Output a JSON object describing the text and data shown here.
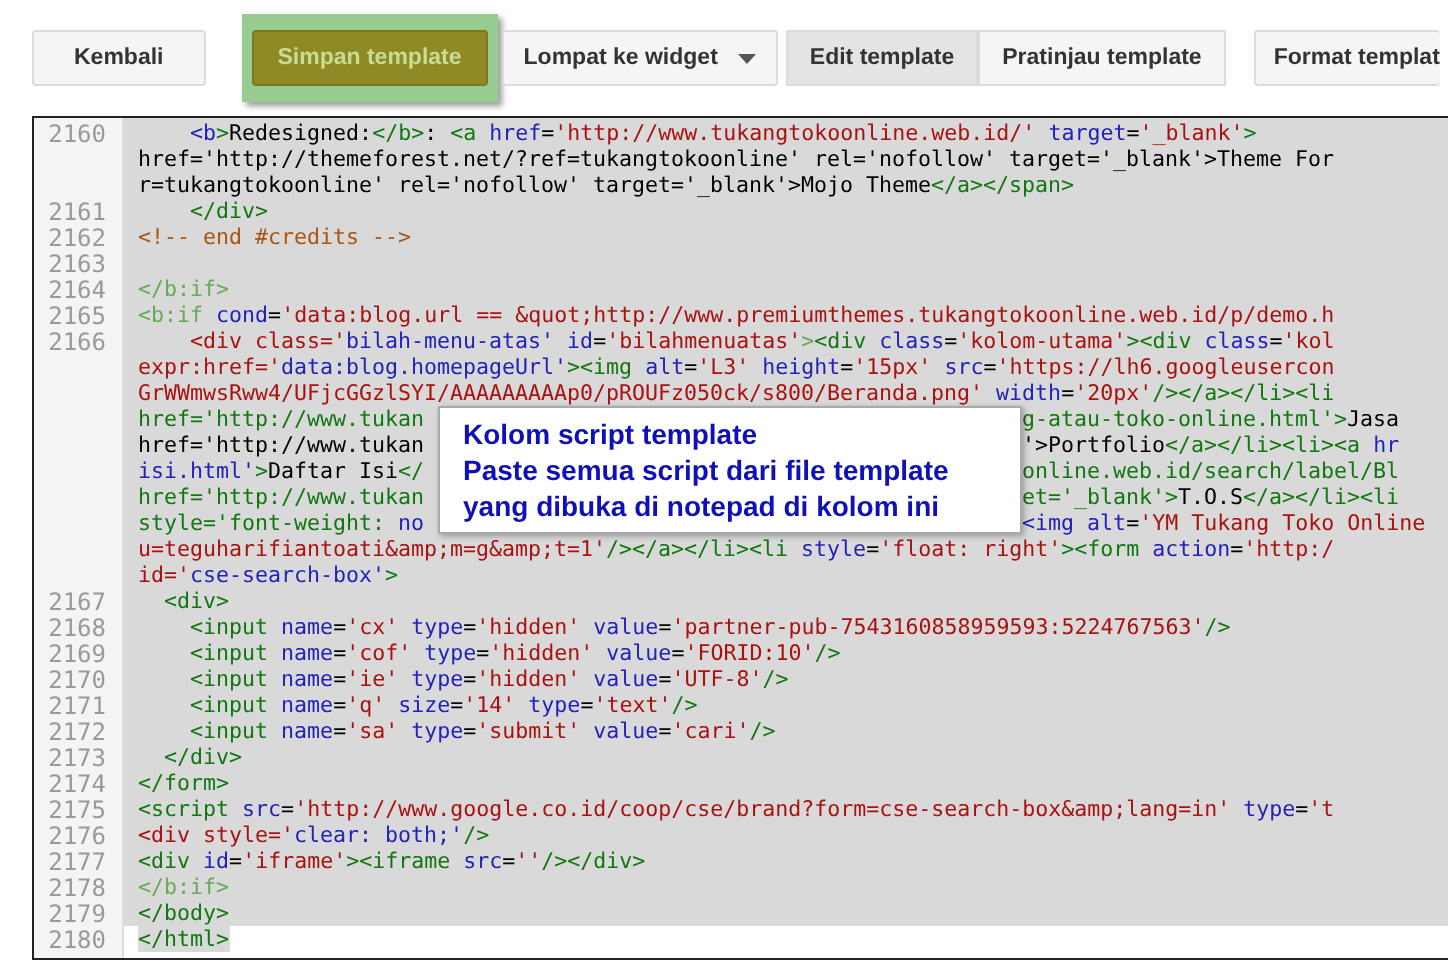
{
  "toolbar": {
    "buttons": [
      {
        "kind": "plain",
        "label": "Kembali"
      },
      {
        "kind": "primary",
        "label": "Simpan template",
        "highlighted": true
      },
      {
        "kind": "dropdown",
        "label": "Lompat ke widget"
      }
    ],
    "view_tabs": [
      {
        "label": "Edit template",
        "selected": true
      },
      {
        "label": "Pratinjau template",
        "selected": false
      }
    ],
    "format_button": {
      "label": "Format templat"
    }
  },
  "editor": {
    "selected": true,
    "rows": [
      {
        "number": "2160",
        "text": "    <b>Redesigned:</b>: <a href='http://www.tukangtokoonline.web.id/' target='_blank'>"
      },
      {
        "text": "href='http://themeforest.net/?ref=tukangtokoonline' rel='nofollow' target='_blank'>Theme For"
      },
      {
        "text": "r=tukangtokoonline' rel='nofollow' target='_blank'>Mojo Theme</a></span>"
      },
      {
        "number": "2161",
        "text": "    </div>"
      },
      {
        "number": "2162",
        "text": "<!-- end #credits -->"
      },
      {
        "number": "2163",
        "text": ""
      },
      {
        "number": "2164",
        "text": "</b:if>"
      },
      {
        "number": "2165",
        "text": "<b:if cond='data:blog.url == &quot;http://www.premiumthemes.tukangtokoonline.web.id/p/demo.h"
      },
      {
        "number": "2166",
        "text": "    <div class='bilah-menu-atas' id='bilahmenuatas'><div class='kolom-utama'><div class='kol"
      },
      {
        "text": "expr:href='data:blog.homepageUrl'><img alt='L3' height='15px' src='https://lh6.googleusercon"
      },
      {
        "text": "GrWWmwsRww4/UFjcGGzlSYI/AAAAAAAAAp0/pROUFz050ck/s800/Beranda.png' width='20px'/></a></li><li"
      },
      {
        "text": "href='http://www.tukan",
        "right": "g-atau-toko-online.html'>Jasa"
      },
      {
        "text": "href='http://www.tukan",
        "right": "'>Portfolio</a></li><li><a hr"
      },
      {
        "text": "isi.html'>Daftar Isi</",
        "right": "online.web.id/search/label/Bl"
      },
      {
        "text": "href='http://www.tukan",
        "right": "et='_blank'>T.O.S</a></li><li"
      },
      {
        "text": "style='font-weight: no",
        "right": "<img alt='YM Tukang Toko Online"
      },
      {
        "text": "u=teguharifiantoati&amp;m=g&amp;t=1'/></a></li><li style='float: right'><form action='http:/"
      },
      {
        "text": "id='cse-search-box'>"
      },
      {
        "number": "2167",
        "text": "  <div>"
      },
      {
        "number": "2168",
        "text": "    <input name='cx' type='hidden' value='partner-pub-7543160858959593:5224767563'/>"
      },
      {
        "number": "2169",
        "text": "    <input name='cof' type='hidden' value='FORID:10'/>"
      },
      {
        "number": "2170",
        "text": "    <input name='ie' type='hidden' value='UTF-8'/>"
      },
      {
        "number": "2171",
        "text": "    <input name='q' size='14' type='text'/>"
      },
      {
        "number": "2172",
        "text": "    <input name='sa' type='submit' value='cari'/>"
      },
      {
        "number": "2173",
        "text": "  </div>"
      },
      {
        "number": "2174",
        "text": "</form>"
      },
      {
        "number": "2175",
        "text": "<script src='http://www.google.co.id/coop/cse/brand?form=cse-search-box&amp;lang=in' type='t"
      },
      {
        "number": "2176",
        "text": "<div style='clear: both;'/>"
      },
      {
        "number": "2177",
        "text": "<div id='iframe'><iframe src=''/></div>"
      },
      {
        "number": "2178",
        "text": "</b:if>"
      },
      {
        "number": "2179",
        "text": "</body>"
      },
      {
        "number": "2180",
        "text": "</html>"
      }
    ]
  },
  "callout": {
    "lines": [
      "Kolom script template",
      "Paste semua script dari file template",
      "yang dibuka di notepad di kolom ini"
    ]
  }
}
